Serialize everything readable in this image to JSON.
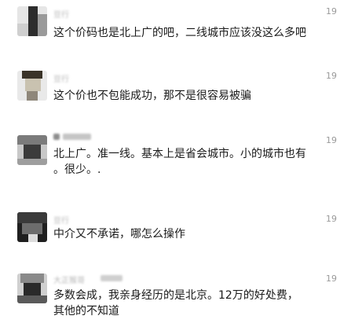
{
  "comments": [
    {
      "name": "豆行",
      "time": "19",
      "text": "这个价码也是北上广的吧，二线城市应该没这么多吧",
      "avatar_colors": [
        "#2d2d2d",
        "#9a9a9a",
        "#e6e6e6"
      ]
    },
    {
      "name": "豆行",
      "time": "19",
      "text": "这个价也不包能成功，那不是很容易被骗",
      "avatar_colors": [
        "#3a3328",
        "#c9c2b0",
        "#e9e9e9"
      ]
    },
    {
      "name": "",
      "time": "19",
      "text": "北上广。准一线。基本上是省会城市。小的城市也有\n。很少。.",
      "avatar_colors": [
        "#3b3b3b",
        "#7b7b7b",
        "#c8c8c8"
      ]
    },
    {
      "name": "豆行",
      "time": "19",
      "text": "中介又不承诺，哪怎么操作",
      "avatar_colors": [
        "#1f1f1f",
        "#6d6d6d",
        "#dcdcdc"
      ]
    },
    {
      "name": "大正猴哥",
      "time": "19",
      "text": "多数会成，我亲身经历的是北京。12万的好处费，\n其他的不知道",
      "avatar_colors": [
        "#2a2a2a",
        "#8a8a8a",
        "#d0d0d0"
      ]
    }
  ]
}
